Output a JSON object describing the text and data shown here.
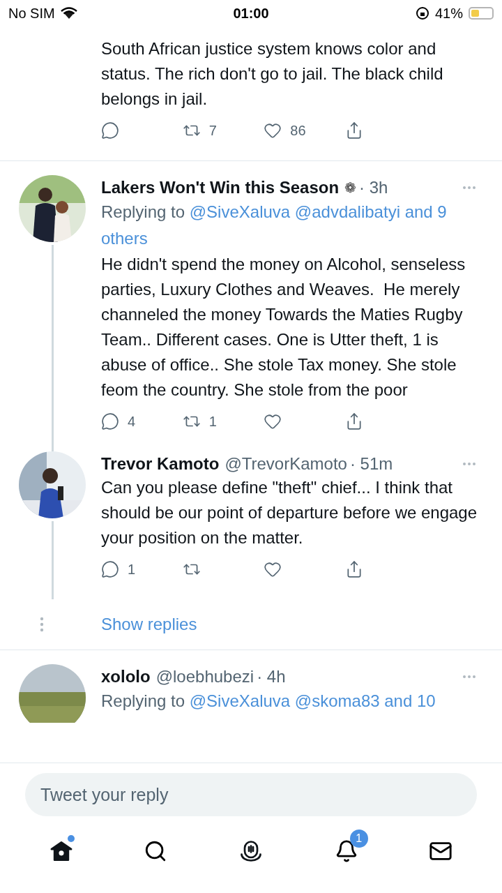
{
  "status_bar": {
    "carrier": "No SIM",
    "time": "01:00",
    "battery": "41%"
  },
  "tweets": [
    {
      "avatar": false,
      "thread_below": false,
      "body": "South African justice system knows color and status. The rich don't go to jail. The black child belongs in jail.",
      "actions": [
        {
          "kind": "reply"
        },
        {
          "kind": "retweet",
          "count": "7"
        },
        {
          "kind": "like",
          "count": "86"
        },
        {
          "kind": "share"
        }
      ]
    },
    {
      "avatar": true,
      "thread_below": true,
      "name": "Lakers Won't Win this Season",
      "badge": "❁",
      "time": "· 3h",
      "replying": {
        "prefix": "Replying to",
        "mentions": "@SiveXaluva @advdalibatyi and 9 others"
      },
      "body": "He didn't spend the money on Alcohol, senseless parties, Luxury Clothes and Weaves.  He merely channeled the money Towards the Maties Rugby Team.. Different cases. One is Utter theft, 1 is abuse of office.. She stole Tax money. She stole feom the country. She stole from the poor",
      "actions": [
        {
          "kind": "reply",
          "count": "4"
        },
        {
          "kind": "retweet",
          "count": "1"
        },
        {
          "kind": "like"
        },
        {
          "kind": "share"
        }
      ]
    },
    {
      "avatar": true,
      "thread_below": true,
      "name": "Trevor Kamoto",
      "handle": "@TrevorKamoto",
      "time": "· 51m",
      "body": "Can you please define \"theft\" chief... I think that should be our point of departure before we engage your position on the matter.",
      "actions": [
        {
          "kind": "reply",
          "count": "1"
        },
        {
          "kind": "retweet"
        },
        {
          "kind": "like"
        },
        {
          "kind": "share"
        }
      ],
      "show_replies": "Show replies"
    },
    {
      "avatar": true,
      "thread_below": false,
      "name": "xololo",
      "handle": "@loebhubezi",
      "time": "· 4h",
      "replying": {
        "prefix": "Replying to",
        "mentions": "@SiveXaluva @skoma83 and 10"
      }
    }
  ],
  "reply_field": {
    "placeholder": "Tweet your reply"
  },
  "nav": [
    {
      "kind": "home",
      "selected": true,
      "dot": true
    },
    {
      "kind": "search",
      "selected": false,
      "dot": false
    },
    {
      "kind": "spaces",
      "selected": false,
      "dot": false
    },
    {
      "kind": "notifications",
      "selected": false,
      "dot": false,
      "badge": "1"
    },
    {
      "kind": "messages",
      "selected": false,
      "dot": false
    }
  ]
}
